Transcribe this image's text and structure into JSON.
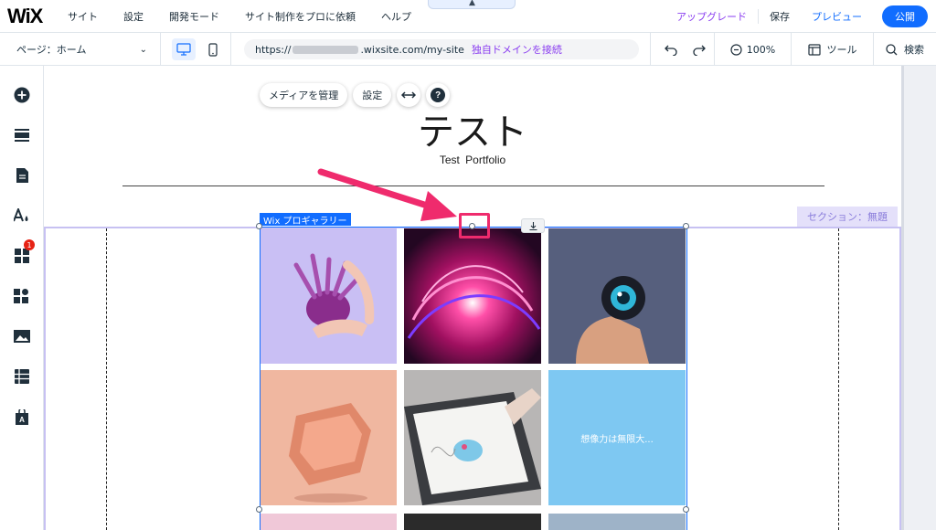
{
  "app": {
    "logo": "WiX"
  },
  "top_menu": {
    "items": [
      "サイト",
      "設定",
      "開発モード",
      "サイト制作をプロに依頼",
      "ヘルプ"
    ]
  },
  "top_right": {
    "upgrade": "アップグレード",
    "save": "保存",
    "preview": "プレビュー",
    "publish": "公開"
  },
  "sub_bar": {
    "page_select": "ページ：ホーム",
    "url_prefix": "https://",
    "url_suffix": ".wixsite.com/my-site",
    "connect_domain": "独自ドメインを接続",
    "zoom": "100%",
    "tools": "ツール",
    "search": "検索"
  },
  "left_tools": {
    "items": [
      "add-icon",
      "sections-icon",
      "pages-icon",
      "design-icon",
      "apps-icon",
      "business-icon",
      "media-icon",
      "cms-icon",
      "app-market-icon"
    ],
    "apps_badge": "1"
  },
  "canvas": {
    "float_tools": {
      "manage_media": "メディアを管理",
      "settings": "設定",
      "help": "?"
    },
    "site_title": "テスト",
    "site_subtitle": "Test Portfolio",
    "section_label": "セクション：無題",
    "gallery_label": "Wix プロギャラリー",
    "gallery_tile_text": "想像力は無限大..."
  },
  "colors": {
    "accent": "#116dff",
    "upgrade": "#8a3ef0",
    "annotation": "#ef2b6d",
    "section": "#8a7ddb"
  }
}
